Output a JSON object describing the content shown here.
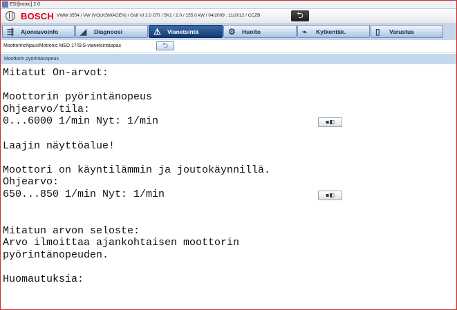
{
  "window": {
    "title": "ESI[tronic] 2.0"
  },
  "brand": {
    "logo_text": "BOSCH",
    "vehicle_info": "VWW 3554 / VW (VOLKSWAGEN) / Golf VI 2.0 GTI / 5K1 / 2.0 / 155.0 kW / 04/2009 . 11/2012 / CCZB",
    "back_glyph": "⮌"
  },
  "tabs": [
    {
      "label": "Ajoneuvoinfo",
      "icon": "car-lift-icon",
      "glyph": "⇶"
    },
    {
      "label": "Diagnoosi",
      "icon": "car-diagnosis-icon",
      "glyph": "◢"
    },
    {
      "label": "Vianetsintä",
      "icon": "troubleshoot-icon",
      "glyph": "⚠"
    },
    {
      "label": "Huolto",
      "icon": "service-wrench-icon",
      "glyph": "⚙"
    },
    {
      "label": "Kytkentäk.",
      "icon": "wiring-diagram-icon",
      "glyph": "⌁"
    },
    {
      "label": "Varustus",
      "icon": "equipment-book-icon",
      "glyph": "▯"
    }
  ],
  "active_tab": "Vianetsintä",
  "breadcrumb": {
    "text": "Moottorinohjaus/Motronic MED 17/SIS-vianetsintäopas",
    "back_glyph": "⮌"
  },
  "section_title": "Moottorin pyörintänopeus",
  "content": {
    "lines": [
      "Mitatut On-arvot:",
      "",
      "Moottorin pyörintänopeus",
      "Ohjearvo/tila:",
      "0...6000 1/min Nyt: 1/min",
      "",
      "Laajin näyttöalue!",
      "",
      "Moottori on käyntilämmin ja joutokäynnillä.",
      "Ohjearvo:",
      "650...850 1/min Nyt: 1/min",
      "",
      "",
      "Mitatun arvon seloste:",
      "Arvo ilmoittaa ajankohtaisen moottorin",
      "pyörintänopeuden.",
      "",
      "Huomautuksia:"
    ],
    "measure_button_glyph": "▪◧"
  }
}
